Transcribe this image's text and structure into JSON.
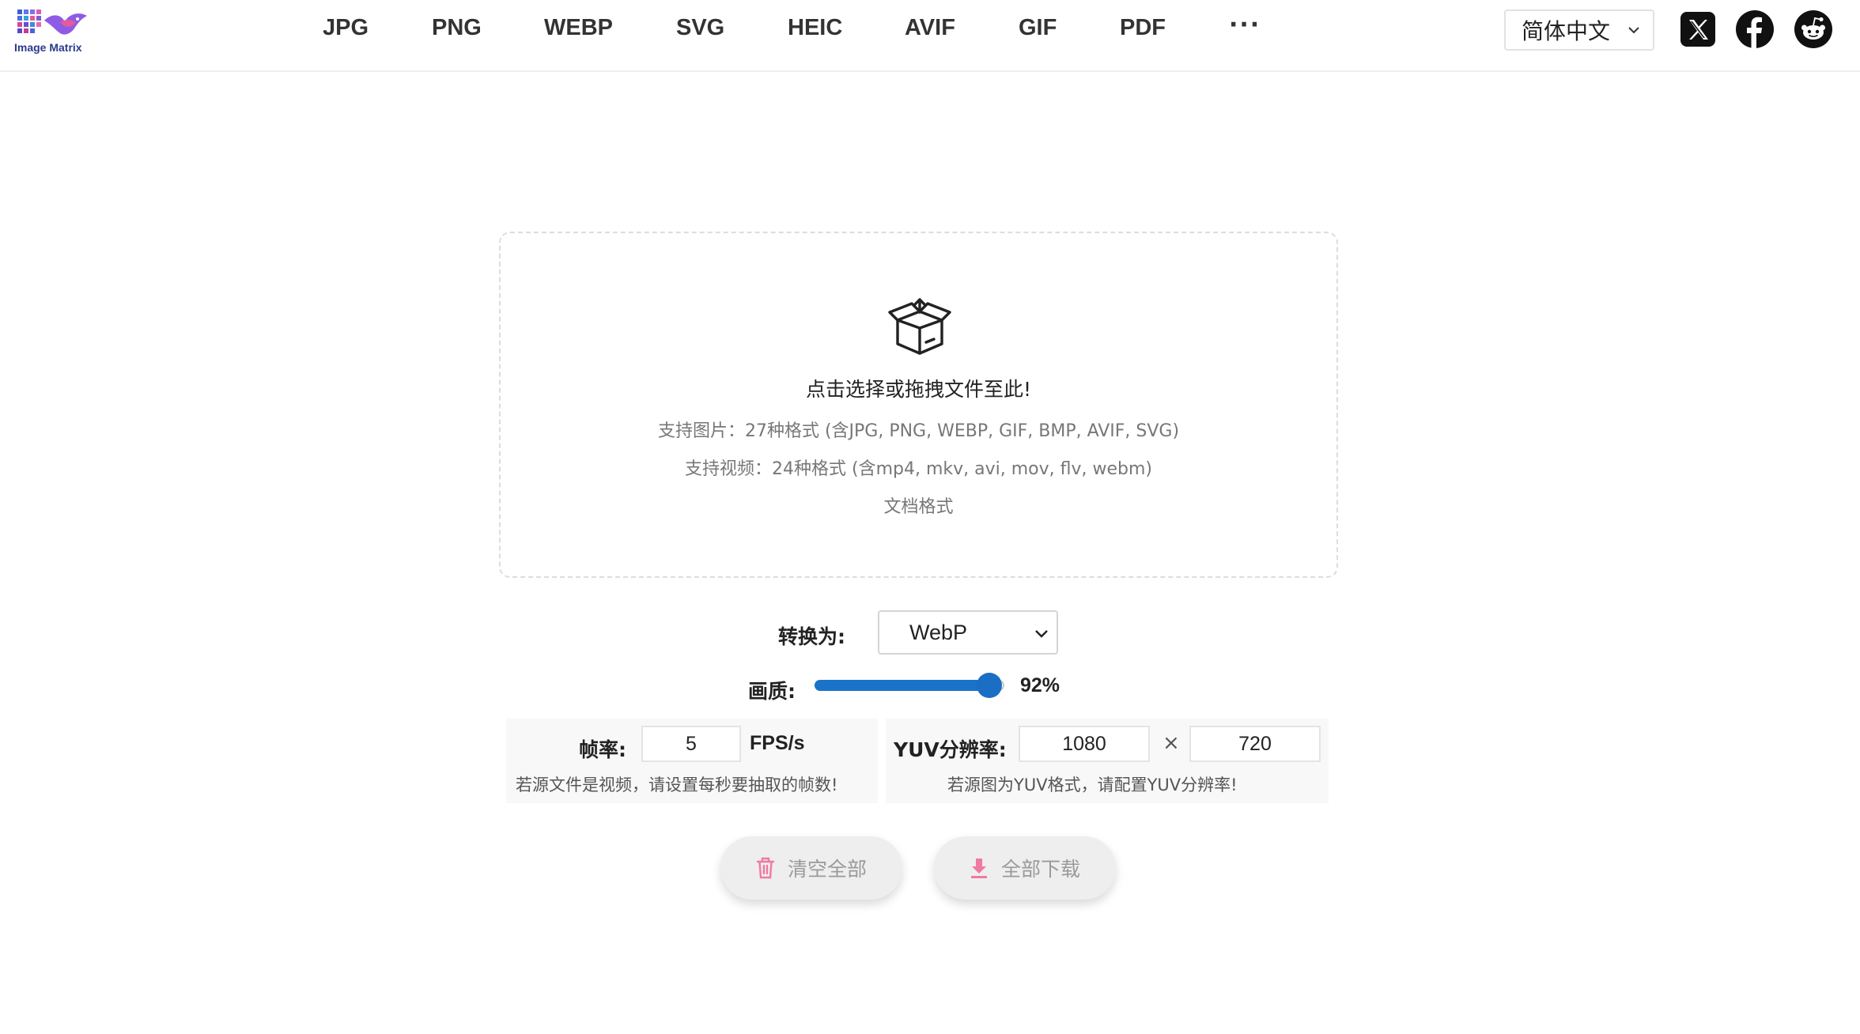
{
  "app": {
    "logo_text": "Image Matrix"
  },
  "nav": {
    "items": [
      "JPG",
      "PNG",
      "WEBP",
      "SVG",
      "HEIC",
      "AVIF",
      "GIF",
      "PDF"
    ],
    "more": "···"
  },
  "header": {
    "language": "简体中文",
    "social_icons": [
      "x-icon",
      "facebook-icon",
      "reddit-icon"
    ]
  },
  "dropzone": {
    "title": "点击选择或拖拽文件至此!",
    "image_formats": "支持图片：27种格式 (含JPG, PNG, WEBP, GIF, BMP, AVIF, SVG)",
    "video_formats": "支持视频：24种格式 (含mp4, mkv, avi, mov, flv, webm)",
    "doc_formats": "文档格式"
  },
  "convert": {
    "label": "转换为:",
    "selected_format": "WebP"
  },
  "quality": {
    "label": "画质:",
    "value": 92,
    "value_text": "92%"
  },
  "framerate": {
    "label": "帧率:",
    "value": "5",
    "unit": "FPS/s",
    "hint": "若源文件是视频，请设置每秒要抽取的帧数!"
  },
  "yuv": {
    "label": "YUV分辨率:",
    "width": "1080",
    "times": "×",
    "height": "720",
    "hint": "若源图为YUV格式，请配置YUV分辨率!"
  },
  "actions": {
    "clear_all": "清空全部",
    "download_all": "全部下载"
  },
  "colors": {
    "accent": "#1a73c8",
    "icon_pink": "#f07aa0"
  }
}
